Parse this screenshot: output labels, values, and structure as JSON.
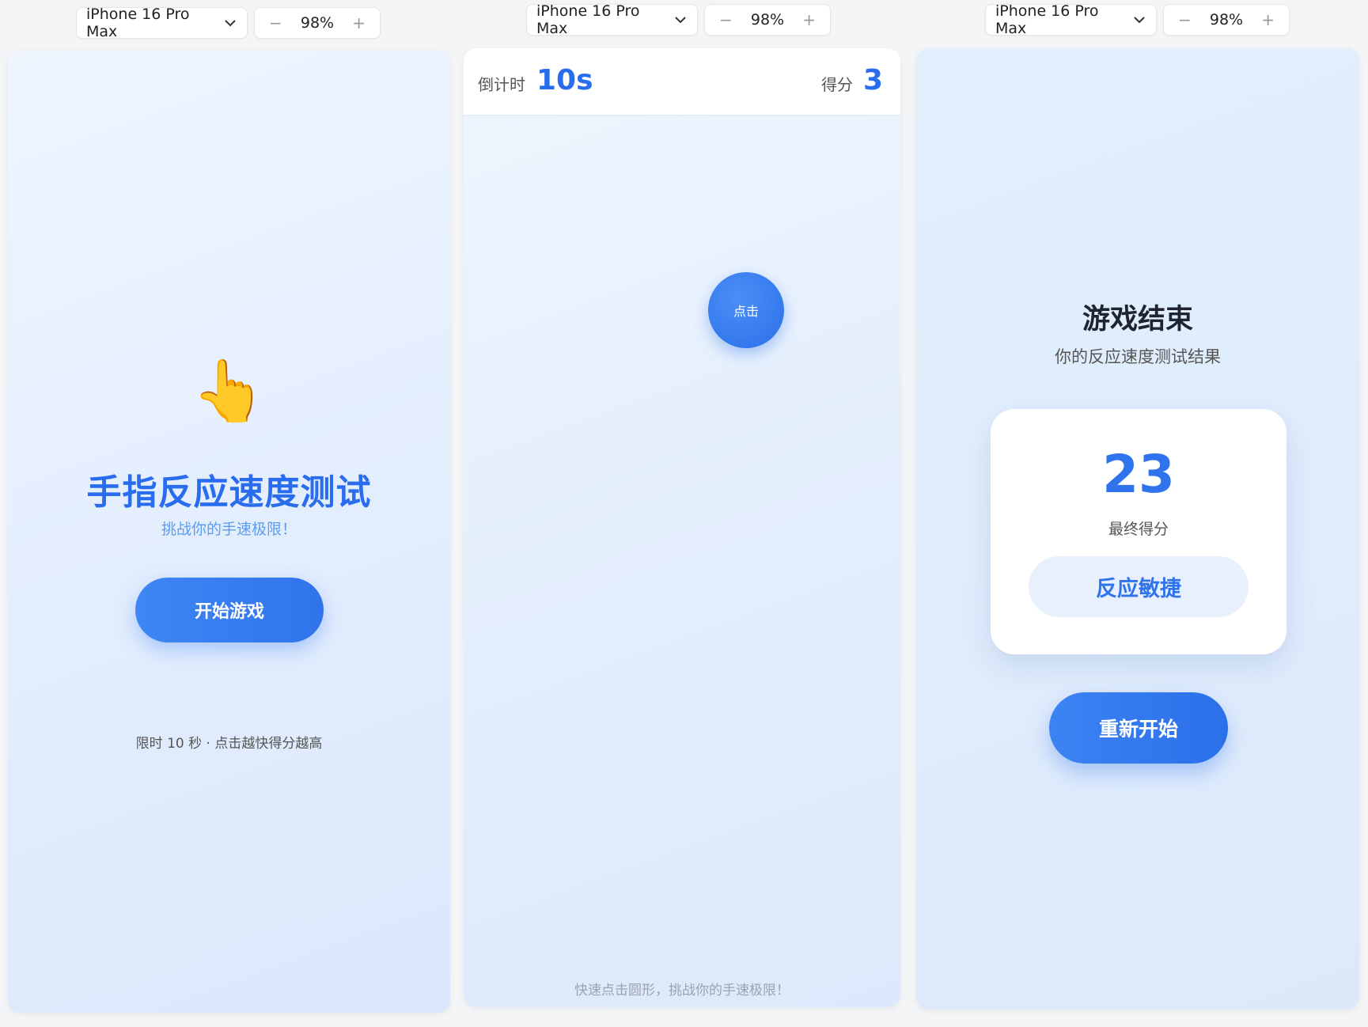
{
  "toolbars": [
    {
      "device": "iPhone 16 Pro Max",
      "zoom": "98%",
      "minus": "−",
      "plus": "+"
    },
    {
      "device": "iPhone 16 Pro Max",
      "zoom": "98%",
      "minus": "−",
      "plus": "+"
    },
    {
      "device": "iPhone 16 Pro Max",
      "zoom": "98%",
      "minus": "−",
      "plus": "+"
    }
  ],
  "start_screen": {
    "emoji": "👆",
    "title": "手指反应速度测试",
    "subtitle": "挑战你的手速极限！",
    "start_button": "开始游戏",
    "rule": "限时 10 秒 · 点击越快得分越高"
  },
  "game_screen": {
    "timer_label": "倒计时",
    "timer_value": "10s",
    "score_label": "得分",
    "score_value": "3",
    "target_label": "点击",
    "hint": "快速点击圆形，挑战你的手速极限！"
  },
  "result_screen": {
    "title": "游戏结束",
    "subtitle": "你的反应速度测试结果",
    "final_score": "23",
    "final_score_label": "最终得分",
    "rating": "反应敏捷",
    "restart_button": "重新开始"
  },
  "colors": {
    "primary": "#2f74ec",
    "background": "#f4f5f7"
  }
}
